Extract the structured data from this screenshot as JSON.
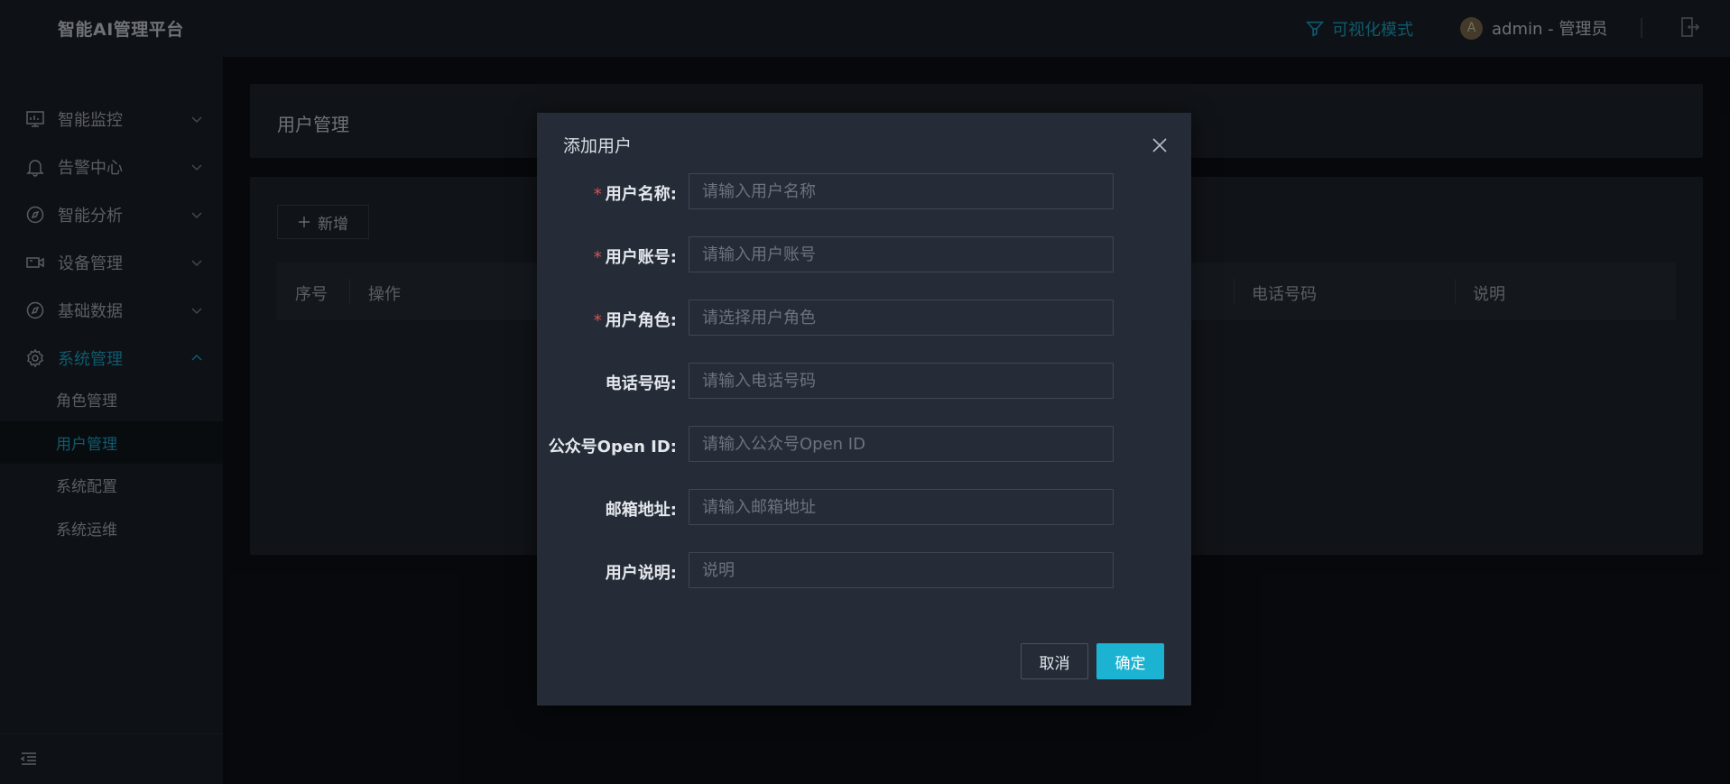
{
  "app": {
    "title": "智能AI管理平台"
  },
  "header": {
    "viz_mode": "可视化模式",
    "avatar_letter": "A",
    "user_label": "admin - 管理员"
  },
  "sidebar": {
    "items": [
      {
        "label": "智能监控",
        "icon": "monitor-icon"
      },
      {
        "label": "告警中心",
        "icon": "bell-icon"
      },
      {
        "label": "智能分析",
        "icon": "compass-icon"
      },
      {
        "label": "设备管理",
        "icon": "camera-icon"
      },
      {
        "label": "基础数据",
        "icon": "compass-icon"
      },
      {
        "label": "系统管理",
        "icon": "gear-icon"
      }
    ],
    "sub_items": [
      {
        "label": "角色管理"
      },
      {
        "label": "用户管理"
      },
      {
        "label": "系统配置"
      },
      {
        "label": "系统运维"
      }
    ]
  },
  "main": {
    "page_title": "用户管理",
    "add_button": "新增",
    "table_columns": [
      "序号",
      "操作",
      "电话号码",
      "说明"
    ]
  },
  "modal": {
    "title": "添加用户",
    "fields": [
      {
        "label": "用户名称:",
        "placeholder": "请输入用户名称",
        "required": true
      },
      {
        "label": "用户账号:",
        "placeholder": "请输入用户账号",
        "required": true
      },
      {
        "label": "用户角色:",
        "placeholder": "请选择用户角色",
        "required": true
      },
      {
        "label": "电话号码:",
        "placeholder": "请输入电话号码",
        "required": false
      },
      {
        "label": "公众号Open ID:",
        "placeholder": "请输入公众号Open ID",
        "required": false
      },
      {
        "label": "邮箱地址:",
        "placeholder": "请输入邮箱地址",
        "required": false
      },
      {
        "label": "用户说明:",
        "placeholder": "说明",
        "required": false
      }
    ],
    "required_mark": "*",
    "cancel": "取消",
    "confirm": "确定"
  },
  "colors": {
    "accent": "#19a7c9",
    "confirm_bg": "#1bb3d1",
    "required": "#d9534f"
  }
}
